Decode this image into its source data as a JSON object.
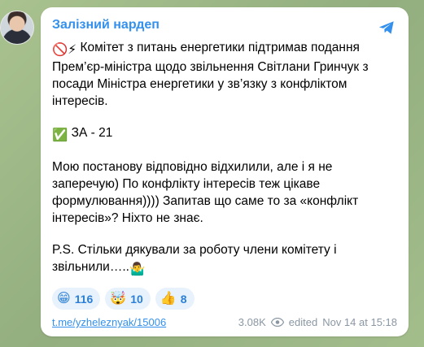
{
  "channel": {
    "name": "Залізний нардеп"
  },
  "message": {
    "p1_prefix_emoji": "🚫⚡",
    "p1_text": "Комітет з питань енергетики підтримав подання Прем’єр-міністра щодо звільнення Світлани Гринчук з посади Міністра енергетики у зв’язку з конфліктом інтересів.",
    "p2_emoji": "✅",
    "p2_text": "ЗА - 21",
    "p3_text": "Мою постанову відповідно відхилили, але і я не заперечую) По конфлікту інтересів теж цікаве формулювання)))) Запитав що саме то за «конфлікт інтересів»? Ніхто не знає.",
    "p4_text": "P.S. Стільки дякували за роботу члени комітету і звільнили…..",
    "p4_suffix_emoji": "🤷‍♂️"
  },
  "reactions": [
    {
      "emoji": "😁",
      "count": "116"
    },
    {
      "emoji": "🤯",
      "count": "10"
    },
    {
      "emoji": "👍",
      "count": "8"
    }
  ],
  "footer": {
    "link": "t.me/yzheleznyak/15006",
    "views": "3.08K",
    "edited": "edited",
    "time": "Nov 14 at 15:18"
  },
  "icons": {
    "share": "telegram-share-icon",
    "views": "eye-icon"
  },
  "colors": {
    "accent": "#3390ec",
    "reaction_bg": "#e8f2fd"
  }
}
